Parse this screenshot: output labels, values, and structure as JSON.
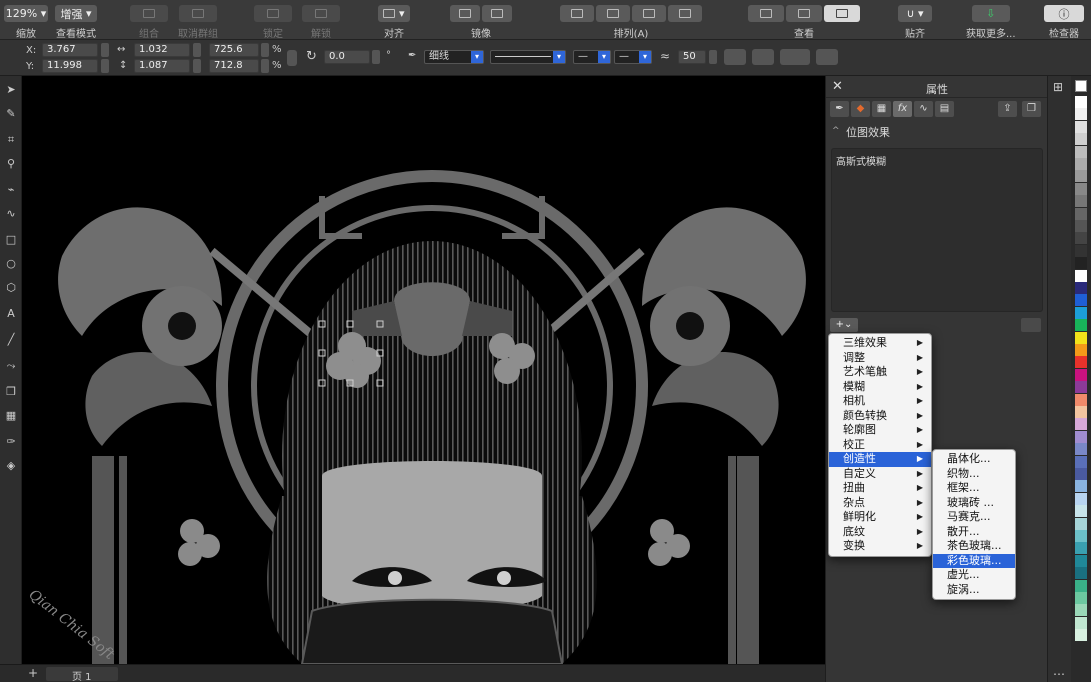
{
  "toolbar": {
    "zoom": "129%",
    "zoom_label": "缩放",
    "view_mode": "增强",
    "view_mode_label": "查看模式",
    "group_label": "组合",
    "ungroup_label": "取消群组",
    "lock_label": "锁定",
    "unlock_label": "解锁",
    "align_label": "对齐",
    "mirror_label": "镜像",
    "arrange_label": "排列(A)",
    "view_label": "查看",
    "snap_label": "贴齐",
    "get_more_label": "获取更多...",
    "inspector_label": "检查器"
  },
  "propbar": {
    "x_label": "X:",
    "x_value": "3.767",
    "y_label": "Y:",
    "y_value": "11.998",
    "w_value": "1.032",
    "h_value": "1.087",
    "sw_value": "725.6",
    "sh_value": "712.8",
    "pct": "%",
    "angle": "0.0",
    "degree": "°",
    "outline": "细线",
    "transparency": "50"
  },
  "panel": {
    "title": "属性",
    "section_title": "位图效果",
    "effect_item": "高斯式模糊"
  },
  "menu": {
    "items": [
      {
        "label": "三维效果"
      },
      {
        "label": "调整"
      },
      {
        "label": "艺术笔触"
      },
      {
        "label": "模糊"
      },
      {
        "label": "相机"
      },
      {
        "label": "颜色转换"
      },
      {
        "label": "轮廓图"
      },
      {
        "label": "校正"
      },
      {
        "label": "创造性"
      },
      {
        "label": "自定义"
      },
      {
        "label": "扭曲"
      },
      {
        "label": "杂点"
      },
      {
        "label": "鲜明化"
      },
      {
        "label": "底纹"
      },
      {
        "label": "变换"
      }
    ],
    "selected_index": 8
  },
  "submenu": {
    "items": [
      {
        "label": "晶体化..."
      },
      {
        "label": "织物..."
      },
      {
        "label": "框架..."
      },
      {
        "label": "玻璃砖 ..."
      },
      {
        "label": "马赛克..."
      },
      {
        "label": "散开..."
      },
      {
        "label": "茶色玻璃..."
      },
      {
        "label": "彩色玻璃..."
      },
      {
        "label": "虚光..."
      },
      {
        "label": "旋涡..."
      }
    ],
    "selected_index": 7
  },
  "status": {
    "add": "+",
    "page": "页 1"
  },
  "canvas": {
    "watermark": "Qian Chia Soft"
  },
  "palette": [
    "#ffffff",
    "#f0f0f0",
    "#e0e0e0",
    "#cfcfcf",
    "#bdbdbd",
    "#acacac",
    "#9a9a9a",
    "#888888",
    "#777777",
    "#666666",
    "#555555",
    "#444444",
    "#333333",
    "#222222",
    "#ffffff",
    "#2a2a7a",
    "#1f5fd6",
    "#1c9fd8",
    "#18b45a",
    "#f2e21a",
    "#f39a19",
    "#e8322b",
    "#c8127f",
    "#8c3a98",
    "#f08a6b",
    "#f3c4a0",
    "#d7a8d8",
    "#a08cd0",
    "#7a88c8",
    "#5a6fb8",
    "#4a5aa0",
    "#8ab4e0",
    "#b8d4f0",
    "#c8e4ea",
    "#a6d4d8",
    "#6cc0c8",
    "#3aa0b0",
    "#208898",
    "#1a7080",
    "#3ab088",
    "#6cc8a0",
    "#9ad8b8",
    "#c0e6d0",
    "#d8f0e0"
  ]
}
